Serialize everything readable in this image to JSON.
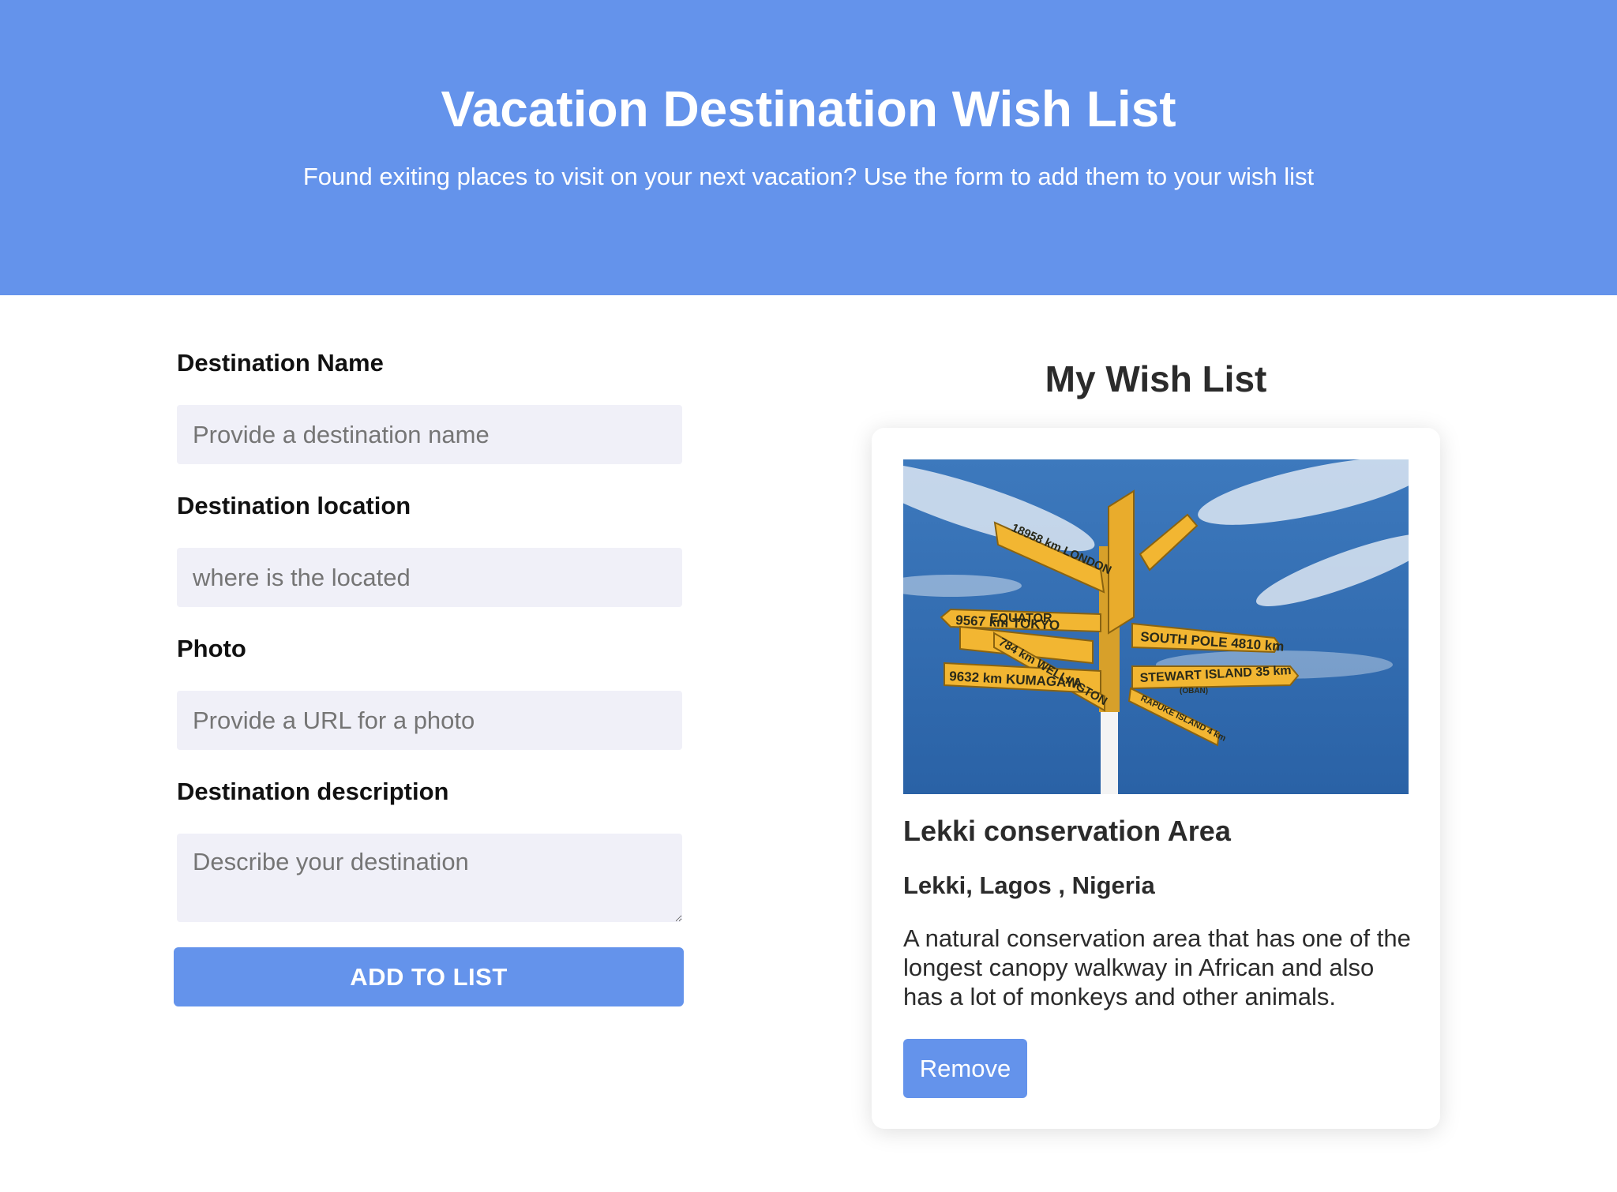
{
  "header": {
    "title": "Vacation Destination Wish List",
    "subtitle": "Found exiting places to visit on your next vacation? Use the form to add them to your wish list"
  },
  "form": {
    "name_label": "Destination Name",
    "name_placeholder": "Provide a destination name",
    "location_label": "Destination location",
    "location_placeholder": "where is the located",
    "photo_label": "Photo",
    "photo_placeholder": "Provide a URL for a photo",
    "description_label": "Destination description",
    "description_placeholder": "Describe your destination",
    "submit_label": "ADD TO LIST"
  },
  "wishlist": {
    "title": "My Wish List",
    "items": [
      {
        "name": "Lekki conservation Area",
        "location": "Lekki, Lagos , Nigeria",
        "description": "A natural conservation area that has one of the longest canopy walkway in African and also has a lot of monkeys and other animals.",
        "remove_label": "Remove",
        "photo_signs": {
          "london": "18958 km  LONDON",
          "equator": "EQUATOR",
          "tokyo": "9567 km  TOKYO",
          "wellington": "784 km  WELLINGTON",
          "kumagaya": "9632 km  KUMAGAYA",
          "south_pole": "SOUTH POLE  4810 km",
          "stewart": "STEWART ISLAND  35 km",
          "oban": "(OBAN)",
          "rapuke": "RAPUKE ISLAND  4 km"
        }
      }
    ]
  },
  "colors": {
    "accent": "#6493eb",
    "input_bg": "#f0f0f8",
    "sign_yellow": "#f2b632",
    "sky": "#2f6bb3"
  }
}
